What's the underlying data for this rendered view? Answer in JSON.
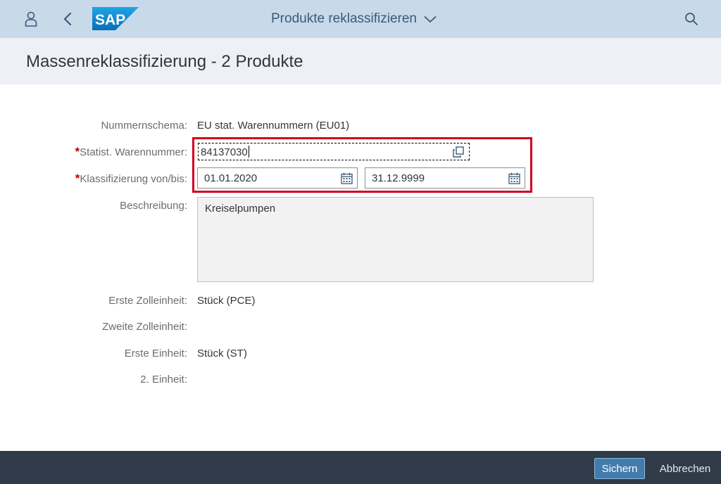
{
  "shell": {
    "logo_text": "SAP",
    "app_title": "Produkte reklassifizieren",
    "icons": [
      "user-icon",
      "back-icon",
      "chevron-down-icon",
      "search-icon"
    ]
  },
  "page": {
    "title": "Massenreklassifizierung - 2 Produkte"
  },
  "form": {
    "schema": {
      "label": "Nummernschema:",
      "value": "EU stat. Warennummern (EU01)"
    },
    "warennummer": {
      "label": "Statist. Warennummer:",
      "value": "84137030",
      "required": true,
      "icon": "value-help-icon"
    },
    "klassifizierung": {
      "label": "Klassifizierung von/bis:",
      "from": "01.01.2020",
      "to": "31.12.9999",
      "required": true,
      "icon": "calendar-icon"
    },
    "beschreibung": {
      "label": "Beschreibung:",
      "value": "Kreiselpumpen"
    },
    "erste_zolleinheit": {
      "label": "Erste Zolleinheit:",
      "value": "Stück (PCE)"
    },
    "zweite_zolleinheit": {
      "label": "Zweite Zolleinheit:",
      "value": ""
    },
    "erste_einheit": {
      "label": "Erste Einheit:",
      "value": "Stück (ST)"
    },
    "zweite_einheit": {
      "label": "2. Einheit:",
      "value": ""
    },
    "required_mark": "*"
  },
  "footer": {
    "save_label": "Sichern",
    "cancel_label": "Abbrechen"
  },
  "colors": {
    "shell_bg": "#c8d9ea",
    "accent": "#427cac",
    "footer_bg": "#2f3b48",
    "highlight": "#d0021b",
    "required": "#bb0000"
  }
}
